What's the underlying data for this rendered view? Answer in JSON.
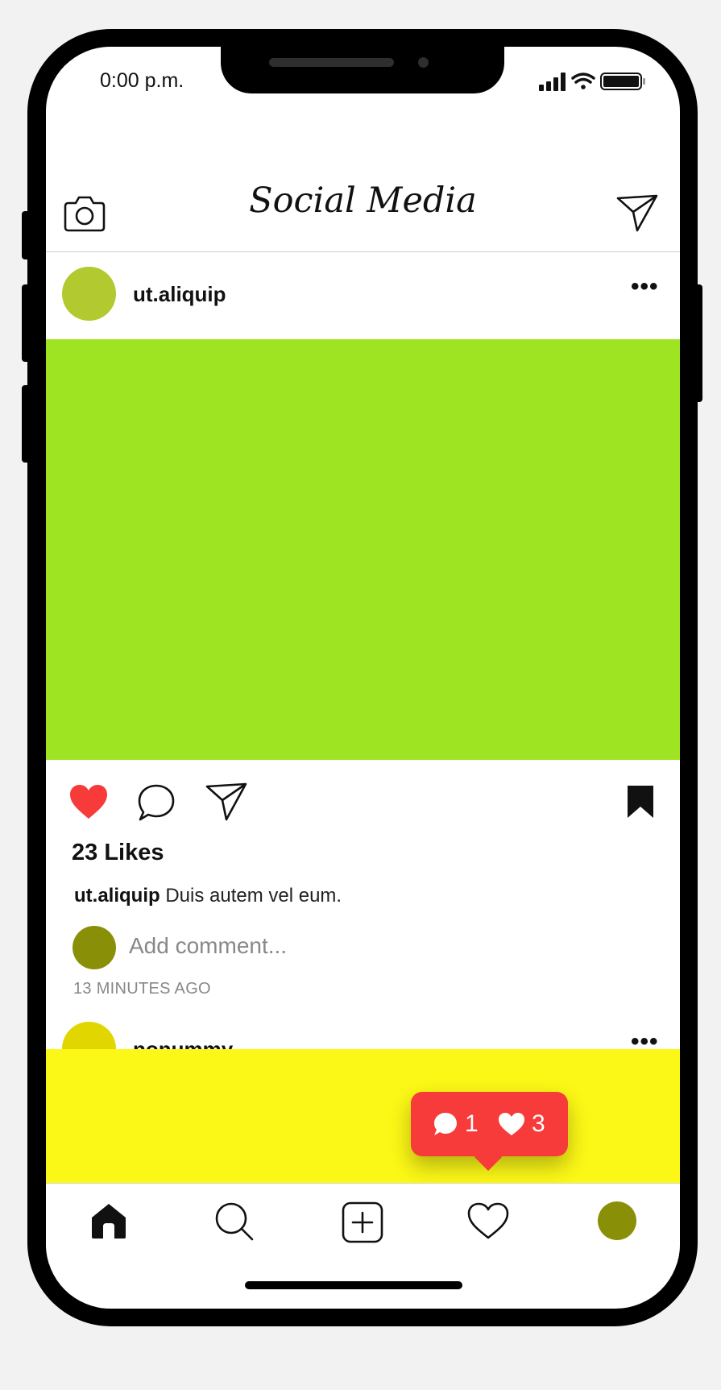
{
  "status_bar": {
    "time": "0:00 p.m."
  },
  "header": {
    "title": "Social Media",
    "camera_icon": "camera-icon",
    "send_icon": "send-icon"
  },
  "posts": [
    {
      "username": "ut.aliquip",
      "avatar_color": "#b2c92f",
      "photo_color": "#9ee423",
      "liked": true,
      "likes": "23 Likes",
      "caption_user": "ut.aliquip",
      "caption_text": "Duis autem vel eum.",
      "comment_placeholder": "Add comment...",
      "time_ago": "13 MINUTES AGO"
    },
    {
      "username": "nonummy",
      "avatar_color": "#e1d600",
      "photo_color": "#fbf716"
    }
  ],
  "comment_avatar_color": "#8a8f08",
  "notification": {
    "comments": "1",
    "likes": "3",
    "color": "#f73a3a"
  },
  "tab_bar": {
    "items": [
      "home-icon",
      "search-icon",
      "add-icon",
      "heart-icon",
      "profile-avatar"
    ],
    "profile_color": "#8a8f08"
  },
  "colors": {
    "like_red": "#f73a3a"
  }
}
